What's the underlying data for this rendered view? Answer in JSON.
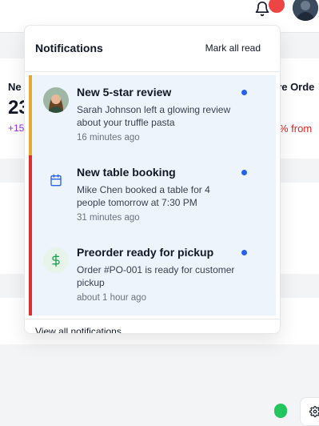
{
  "background": {
    "stat_left_label": "Ne",
    "stat_left_value": "23",
    "stat_left_change": "+15",
    "stat_right_label": "ve Orde",
    "stat_right_change": "% from"
  },
  "topbar": {
    "bell_icon": "bell-icon",
    "avatar_icon": "user-avatar"
  },
  "notifications_panel": {
    "title": "Notifications",
    "mark_all_label": "Mark all read",
    "items": [
      {
        "title": "New 5-star review",
        "message": "Sarah Johnson left a glowing review about your truffle pasta",
        "time": "16 minutes ago",
        "icon": "reviewer-avatar",
        "unread": true,
        "accent": "#e5a935"
      },
      {
        "title": "New table booking",
        "message": "Mike Chen booked a table for 4 people tomorrow at 7:30 PM",
        "time": "31 minutes ago",
        "icon": "calendar-icon",
        "unread": true,
        "accent": "#dc2f2f"
      },
      {
        "title": "Preorder ready for pickup",
        "message": "Order #PO-001 is ready for customer pickup",
        "time": "about 1 hour ago",
        "icon": "dollar-icon",
        "unread": true,
        "accent": "#dc2f2f"
      }
    ],
    "footer_label": "View all notifications"
  },
  "colors": {
    "unread_dot": "#2563eb",
    "item_bg": "#eef4fc",
    "badge": "#ef4444",
    "stat_positive": "#9333ea",
    "stat_negative": "#dc2626"
  }
}
